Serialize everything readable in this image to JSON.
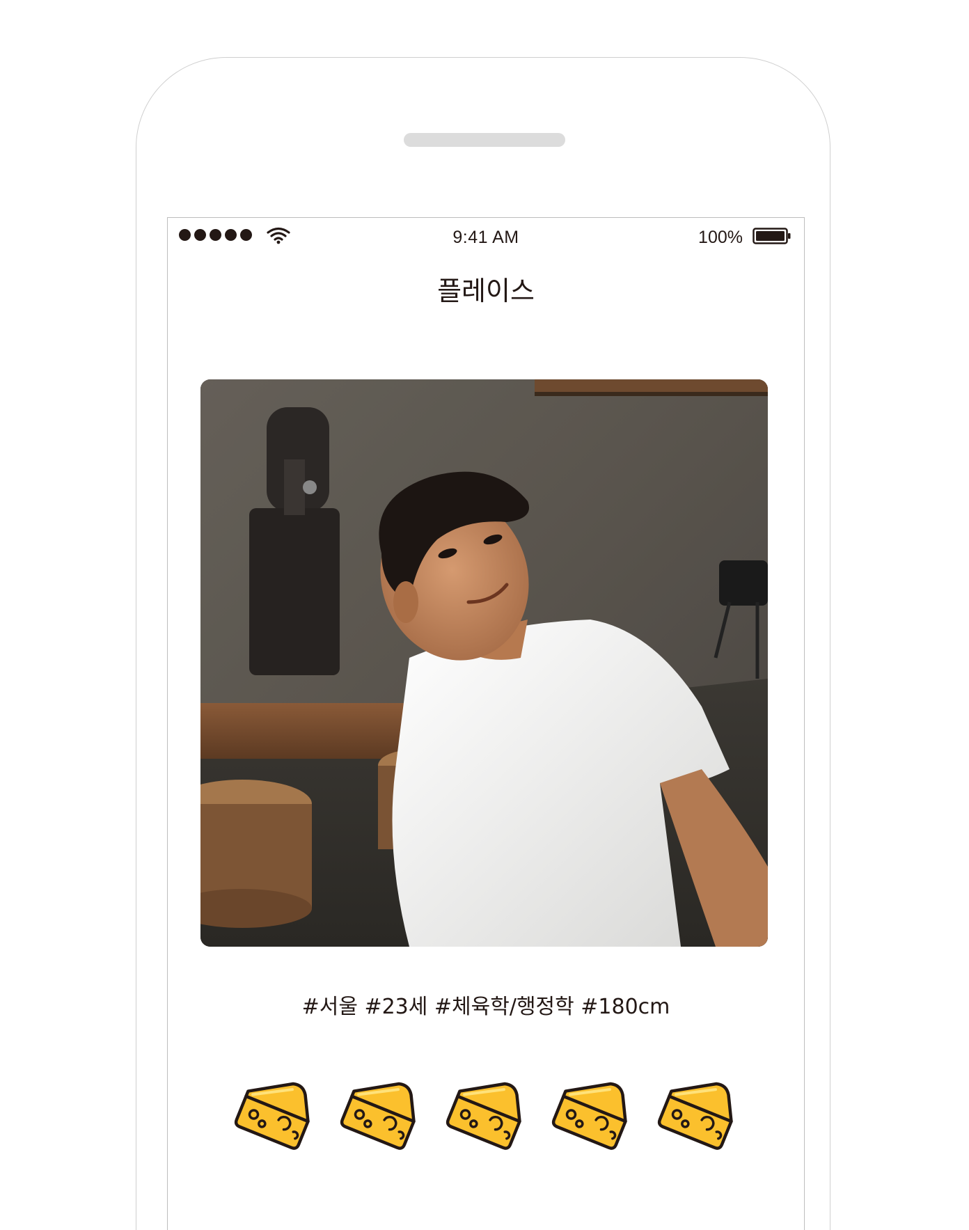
{
  "status_bar": {
    "time": "9:41 AM",
    "battery_percent": "100%",
    "signal_dots": 5,
    "signal_icon": "cellular-signal-icon",
    "wifi_icon": "wifi-icon",
    "battery_icon": "battery-icon",
    "battery_level": 1.0
  },
  "header": {
    "title": "플레이스"
  },
  "profile": {
    "photo_icon": "profile-photo",
    "tags": "#서울 #23세 #체육학/행정학 #180cm"
  },
  "rating": {
    "icon": "cheese-icon",
    "count": 5,
    "color": "#FBC02D",
    "outline_color": "#231815"
  }
}
